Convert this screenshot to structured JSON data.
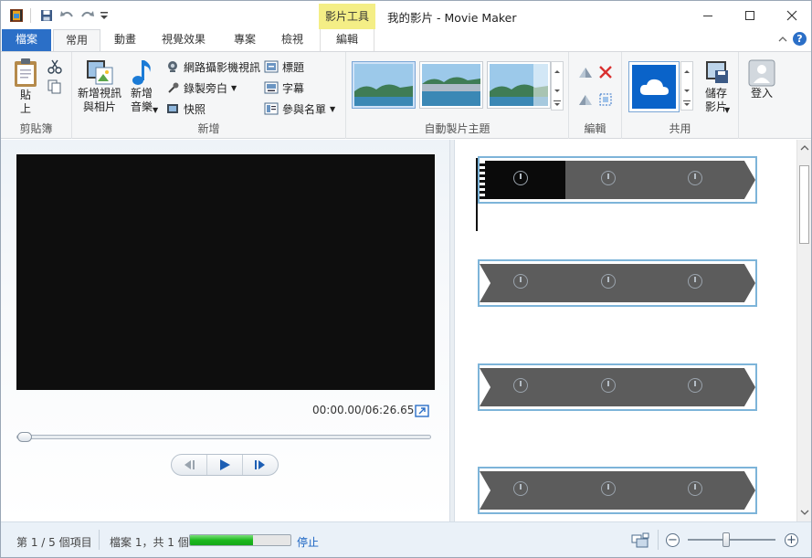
{
  "window": {
    "title": "我的影片 - Movie Maker",
    "context_group": "影片工具"
  },
  "tabs": [
    {
      "label": "檔案"
    },
    {
      "label": "常用"
    },
    {
      "label": "動畫"
    },
    {
      "label": "視覺效果"
    },
    {
      "label": "專案"
    },
    {
      "label": "檢視"
    },
    {
      "label": "編輯"
    }
  ],
  "ribbon": {
    "clipboard": {
      "label": "剪貼簿",
      "paste": "貼\n上"
    },
    "add": {
      "label": "新增",
      "add_video": "新增視訊\n與相片",
      "add_music": "新增\n音樂",
      "webcam": "網路攝影機視訊",
      "narration": "錄製旁白",
      "snapshot": "快照",
      "title": "標題",
      "caption": "字幕",
      "credits": "參與名單"
    },
    "themes": {
      "label": "自動製片主題"
    },
    "editing": {
      "label": "編輯"
    },
    "share": {
      "label": "共用",
      "save_movie": "儲存\n影片"
    },
    "signin": "登入"
  },
  "preview": {
    "timecode": "00:00.00/06:26.65"
  },
  "playback": {
    "position": 0
  },
  "storyboard": {
    "clip_count": 4
  },
  "status": {
    "items": "第 1 / 5 個項目",
    "file": "檔案 1，共 1 個",
    "progress": 0.63,
    "stop": "停止",
    "zoom": 0.44
  },
  "colors": {
    "accent": "#2b6fc7",
    "context_tab": "#f4ee86",
    "progress": "#1db81e",
    "clip_border": "#7db4d9"
  }
}
